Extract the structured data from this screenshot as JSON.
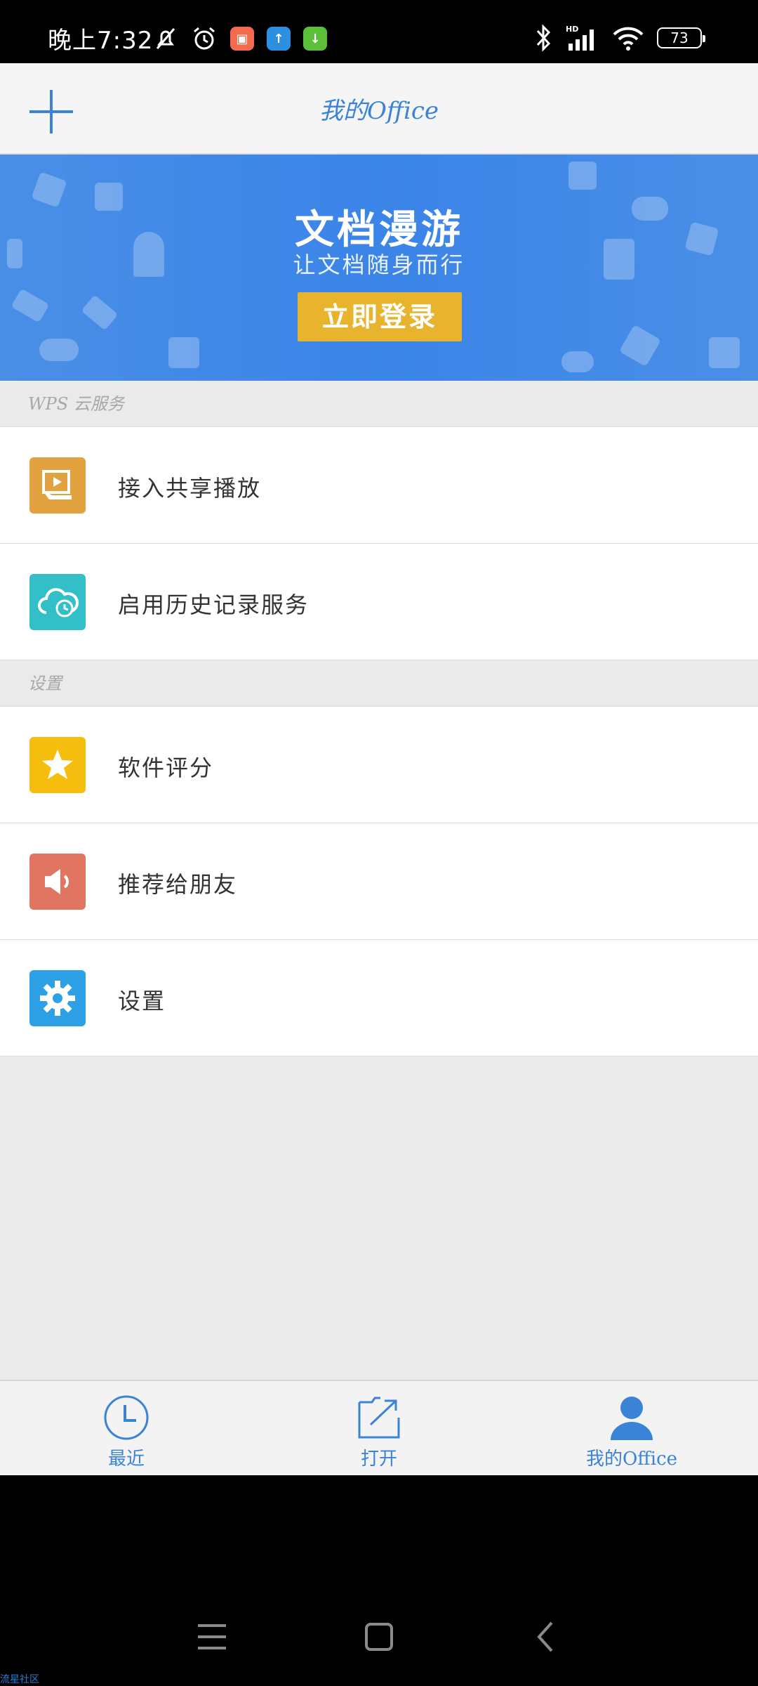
{
  "status_bar": {
    "time": "晚上7:32",
    "battery": "73"
  },
  "header": {
    "title": "我的Office"
  },
  "banner": {
    "title": "文档漫游",
    "subtitle": "让文档随身而行",
    "button_label": "立即登录"
  },
  "sections": {
    "cloud": {
      "header": "WPS 云服务",
      "items": [
        {
          "label": "接入共享播放",
          "icon": "share-play-icon",
          "color": "#e2a23f"
        },
        {
          "label": "启用历史记录服务",
          "icon": "cloud-history-icon",
          "color": "#33bfc8"
        }
      ]
    },
    "settings": {
      "header": "设置",
      "items": [
        {
          "label": "软件评分",
          "icon": "star-icon",
          "color": "#f5be0f"
        },
        {
          "label": "推荐给朋友",
          "icon": "speaker-icon",
          "color": "#e07662"
        },
        {
          "label": "设置",
          "icon": "gear-icon",
          "color": "#2ea0e6"
        }
      ]
    }
  },
  "bottom_nav": {
    "items": [
      {
        "label": "最近",
        "icon": "clock-icon"
      },
      {
        "label": "打开",
        "icon": "open-folder-icon"
      },
      {
        "label": "我的Office",
        "icon": "person-icon"
      }
    ]
  },
  "watermark": "流星社区",
  "colors": {
    "accent": "#3a83d6",
    "banner": "#3b84e8",
    "banner_button": "#e9b42d"
  }
}
